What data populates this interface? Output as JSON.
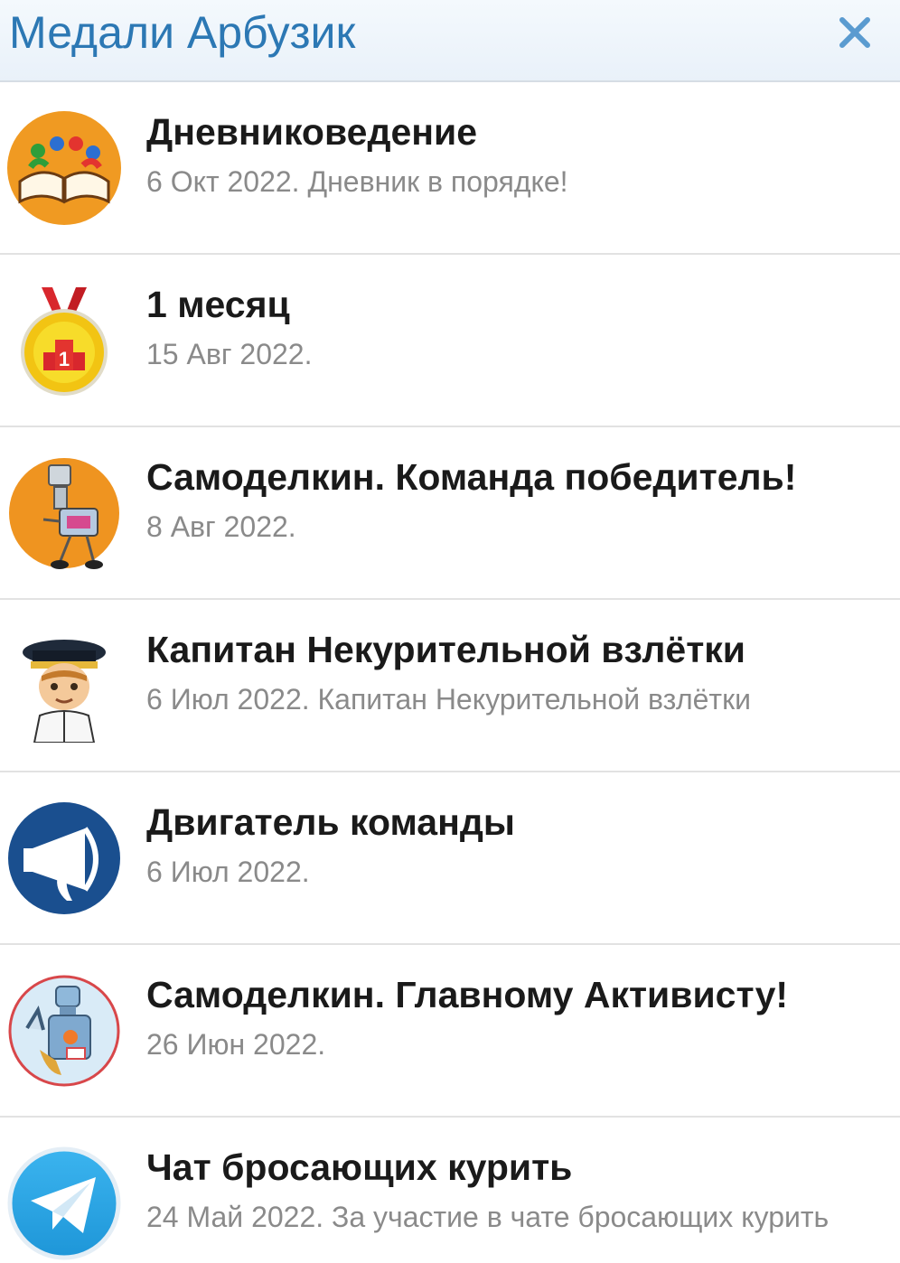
{
  "header": {
    "title": "Медали Арбузик",
    "close_icon": "close-icon",
    "accent_color": "#2c78b4"
  },
  "medals": [
    {
      "title": "Дневниковедение",
      "subtitle": "6 Окт 2022. Дневник в порядке!",
      "icon": "diary-book-icon"
    },
    {
      "title": "1 месяц",
      "subtitle": "15 Авг 2022.",
      "icon": "gold-medal-icon"
    },
    {
      "title": "Самоделкин. Команда победитель!",
      "subtitle": "8 Авг 2022.",
      "icon": "robot-icon"
    },
    {
      "title": "Капитан Некурительной взлётки",
      "subtitle": "6 Июл 2022. Капитан Некурительной взлётки",
      "icon": "pilot-captain-icon"
    },
    {
      "title": "Двигатель команды",
      "subtitle": "6 Июл 2022.",
      "icon": "megaphone-icon"
    },
    {
      "title": "Самоделкин. Главному Активисту!",
      "subtitle": "26 Июн 2022.",
      "icon": "robot-activist-icon"
    },
    {
      "title": "Чат бросающих курить",
      "subtitle": "24 Май 2022. За участие в чате бросающих курить",
      "icon": "telegram-plane-icon"
    }
  ]
}
